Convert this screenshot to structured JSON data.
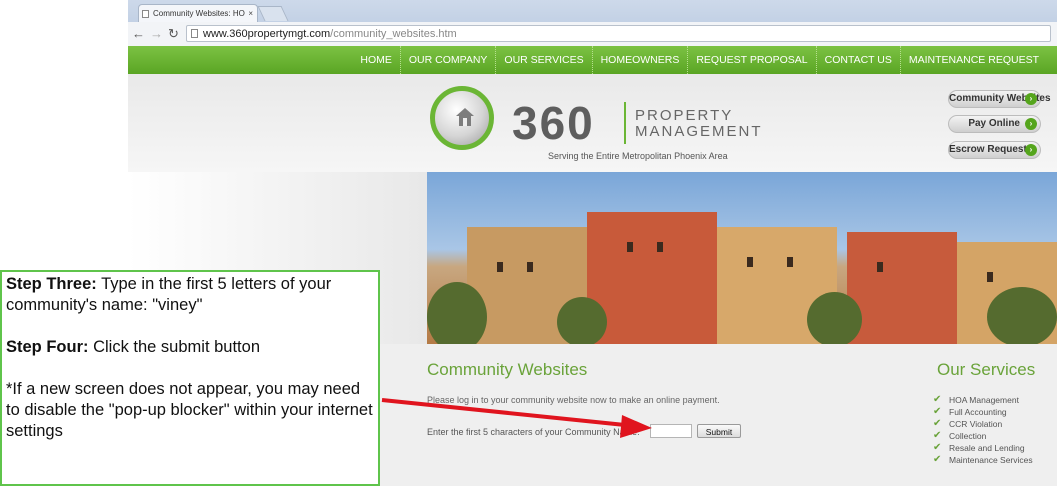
{
  "browser": {
    "tab_title": "Community Websites: HO",
    "tab_close": "×",
    "url_host": "www.360propertymgt.com",
    "url_path": "/community_websites.htm"
  },
  "nav": [
    "HOME",
    "OUR COMPANY",
    "OUR SERVICES",
    "HOMEOWNERS",
    "REQUEST PROPOSAL",
    "CONTACT US",
    "MAINTENANCE REQUEST"
  ],
  "logo": {
    "number": "360",
    "line1": "PROPERTY",
    "line2": "MANAGEMENT",
    "tagline": "Serving the Entire Metropolitan Phoenix Area"
  },
  "side_buttons": {
    "community": "Community Websites",
    "pay": "Pay Online",
    "escrow": "Escrow Requests"
  },
  "content": {
    "title": "Community Websites",
    "intro": "Please log in to your community website now to make an online payment.",
    "label": "Enter the first 5 characters of your Community Name:",
    "submit": "Submit"
  },
  "services": {
    "title": "Our Services",
    "items": [
      "HOA Management",
      "Full Accounting",
      "CCR Violation",
      "Collection",
      "Resale and Lending",
      "Maintenance Services"
    ]
  },
  "annotation": {
    "step3_bold": "Step Three:",
    "step3_text": "   Type in the first 5 letters of your community's name:  \"viney\"",
    "step4_bold": "Step Four:",
    "step4_text": "  Click the submit button",
    "note": "*If a new screen does not appear, you may need to disable the \"pop-up blocker\" within your internet settings"
  },
  "colors": {
    "brand_green": "#6aa33a",
    "nav_green": "#5aa524",
    "arrow_red": "#e0141e"
  }
}
